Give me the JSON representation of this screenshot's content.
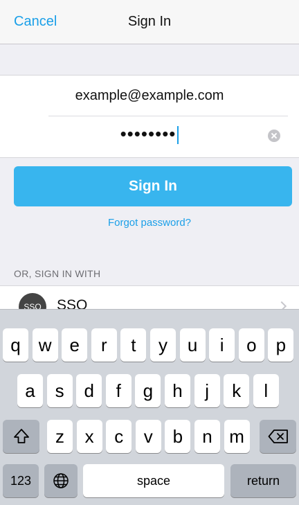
{
  "nav": {
    "cancel_label": "Cancel",
    "title": "Sign In"
  },
  "form": {
    "email_value": "example@example.com",
    "password_mask": "••••••••"
  },
  "sign_in_label": "Sign In",
  "forgot_label": "Forgot password?",
  "alt_header": "OR, SIGN IN WITH",
  "sso": {
    "avatar_text": "SSO",
    "label": "SSO"
  },
  "keyboard": {
    "row1": [
      "q",
      "w",
      "e",
      "r",
      "t",
      "y",
      "u",
      "i",
      "o",
      "p"
    ],
    "row2": [
      "a",
      "s",
      "d",
      "f",
      "g",
      "h",
      "j",
      "k",
      "l"
    ],
    "row3": [
      "z",
      "x",
      "c",
      "v",
      "b",
      "n",
      "m"
    ],
    "numbers_label": "123",
    "space_label": "space",
    "return_label": "return"
  },
  "icons": {
    "clear": "clear-circle-icon",
    "chevron": "chevron-right-icon",
    "shift": "shift-icon",
    "delete": "backspace-icon",
    "globe": "globe-icon"
  },
  "colors": {
    "accent": "#1a9fe8",
    "button": "#38b5ee",
    "keyboard": "#d1d5db"
  }
}
